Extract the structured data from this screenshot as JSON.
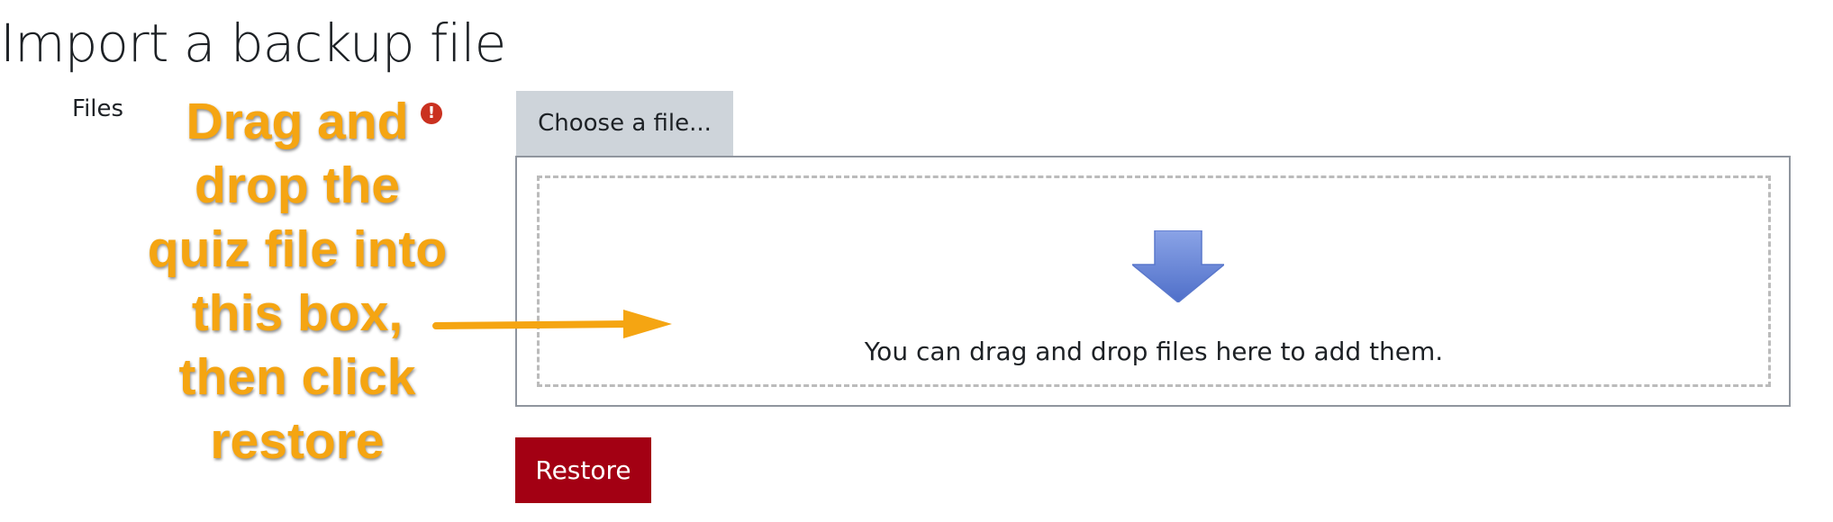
{
  "page": {
    "title": "Import a backup file"
  },
  "form": {
    "files_label": "Files",
    "required_icon": "exclamation-circle-icon",
    "required_symbol": "!",
    "choose_file_label": "Choose a file...",
    "dropzone_icon": "arrow-down-icon",
    "dropzone_text": "You can drag and drop files here to add them.",
    "restore_label": "Restore"
  },
  "annotation": {
    "lines": [
      "Drag and",
      "drop the",
      "quiz file into",
      "this box,",
      "then click",
      "restore"
    ],
    "arrow_icon": "arrow-right-icon",
    "color": "#f5a512"
  },
  "colors": {
    "restore_button": "#a30013",
    "choose_file_button": "#ced4da",
    "required_icon": "#ca3120",
    "dropzone_arrow": "#6b88d6"
  }
}
